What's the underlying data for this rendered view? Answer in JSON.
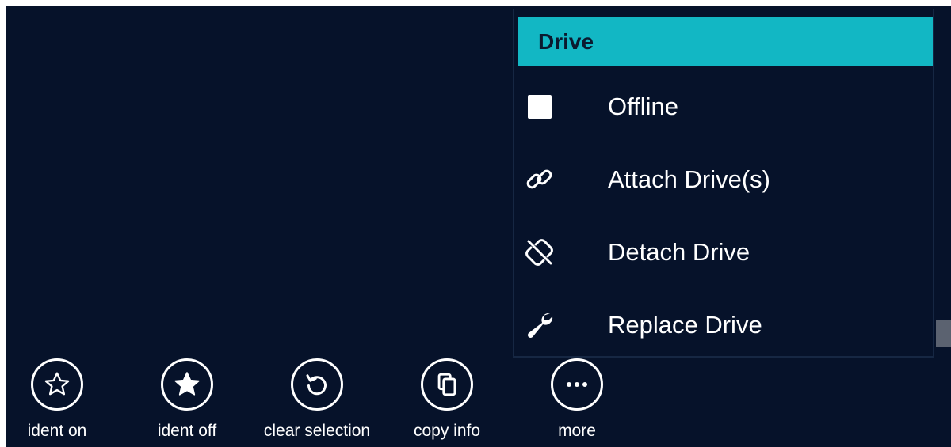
{
  "menu": {
    "header": "Drive",
    "items": [
      {
        "label": "Offline",
        "icon": "checkbox-icon"
      },
      {
        "label": "Attach Drive(s)",
        "icon": "link-icon"
      },
      {
        "label": "Detach Drive",
        "icon": "unlink-icon"
      },
      {
        "label": "Replace Drive",
        "icon": "wrench-icon"
      }
    ]
  },
  "actions": [
    {
      "label": "ident on",
      "icon": "star-outline-icon"
    },
    {
      "label": "ident off",
      "icon": "star-filled-icon"
    },
    {
      "label": "clear selection",
      "icon": "undo-icon"
    },
    {
      "label": "copy info",
      "icon": "copy-icon"
    },
    {
      "label": "more",
      "icon": "more-icon"
    }
  ],
  "colors": {
    "background": "#06122a",
    "accent": "#12b7c4",
    "text": "#ffffff"
  }
}
